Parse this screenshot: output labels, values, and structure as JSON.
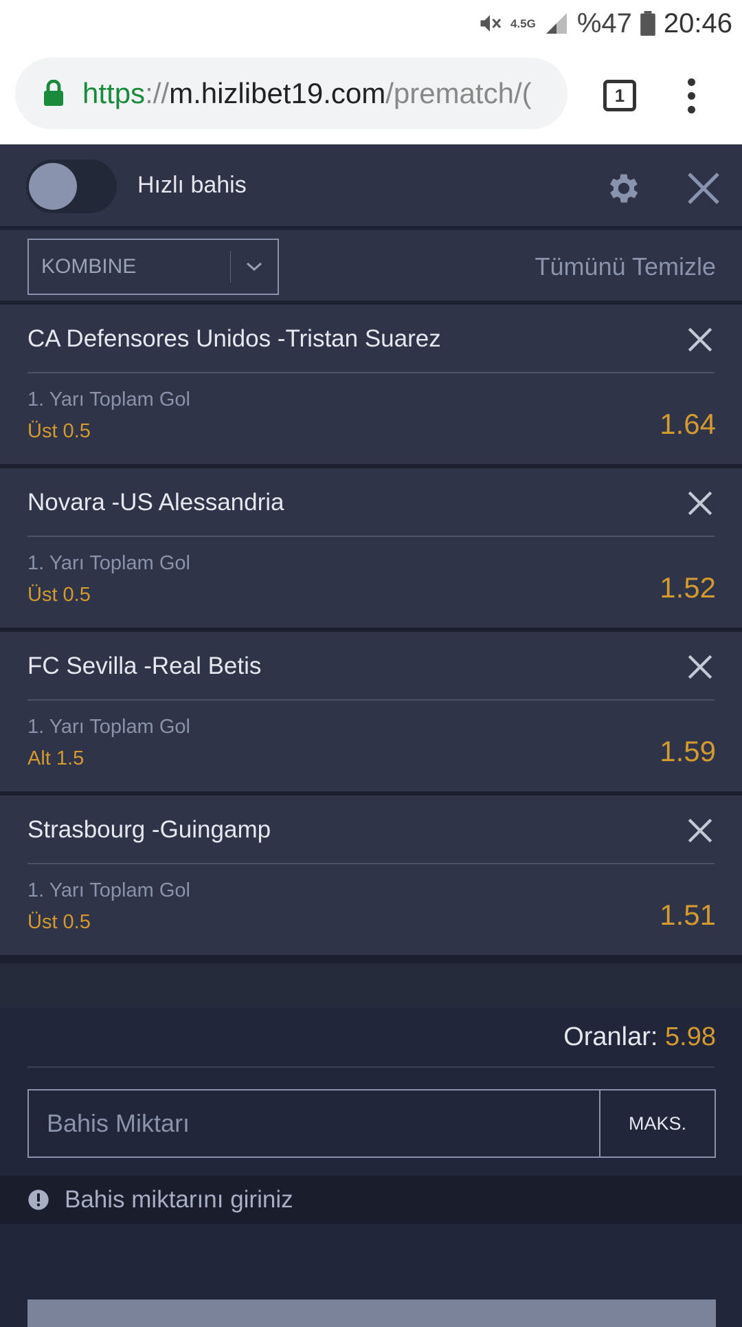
{
  "status_bar": {
    "network": "4.5G",
    "battery": "%47",
    "time": "20:46"
  },
  "browser": {
    "url_scheme": "https",
    "url_sep": "://",
    "url_host": "m.hizlibet19.com",
    "url_path": "/prematch/(",
    "tab_count": "1"
  },
  "header": {
    "quick_bet_label": "Hızlı bahis"
  },
  "betslip": {
    "type": "KOMBINE",
    "clear_all": "Tümünü Temizle",
    "bets": [
      {
        "match": "CA Defensores Unidos -Tristan Suarez",
        "market": "1. Yarı Toplam Gol",
        "selection": "Üst 0.5",
        "odds": "1.64"
      },
      {
        "match": "Novara -US Alessandria",
        "market": "1. Yarı Toplam Gol",
        "selection": "Üst 0.5",
        "odds": "1.52"
      },
      {
        "match": "FC Sevilla -Real Betis",
        "market": "1. Yarı Toplam Gol",
        "selection": "Alt 1.5",
        "odds": "1.59"
      },
      {
        "match": "Strasbourg -Guingamp",
        "market": "1. Yarı Toplam Gol",
        "selection": "Üst 0.5",
        "odds": "1.51"
      }
    ],
    "total_label": "Oranlar:",
    "total_odds": "5.98",
    "stake_placeholder": "Bahis Miktarı",
    "max_label": "MAKS.",
    "warning": "Bahis miktarını giriniz"
  },
  "colors": {
    "accent": "#d39a2e",
    "panel": "#2f3448",
    "background": "#21263a"
  }
}
